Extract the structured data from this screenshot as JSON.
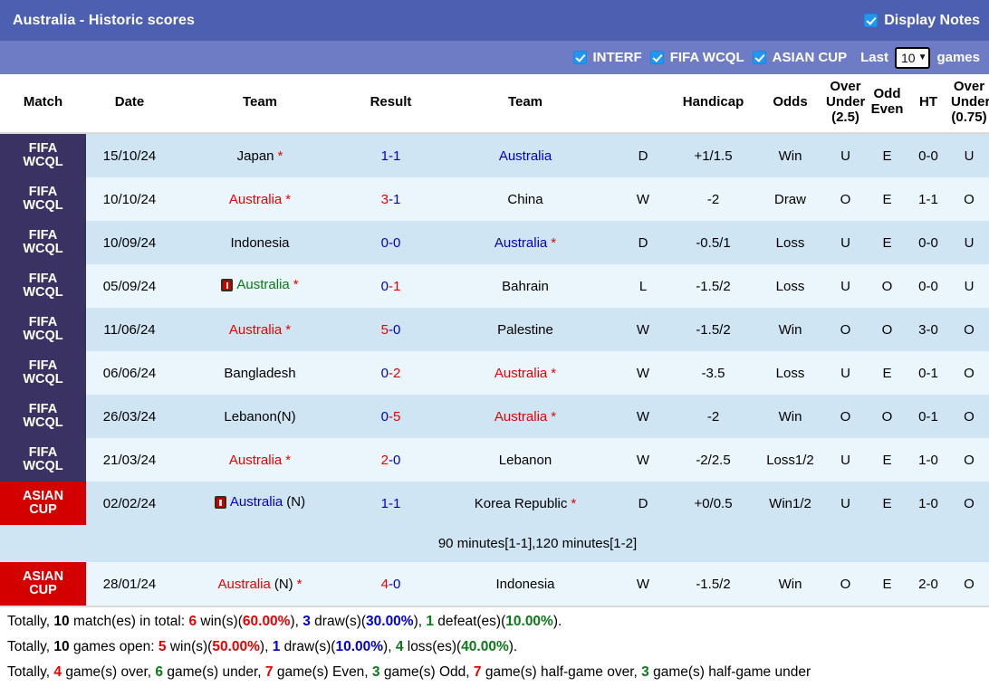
{
  "header": {
    "title": "Australia - Historic scores",
    "display_notes_label": "Display Notes",
    "display_notes_checked": true,
    "filters": [
      {
        "label": "INTERF",
        "checked": true
      },
      {
        "label": "FIFA WCQL",
        "checked": true
      },
      {
        "label": "ASIAN CUP",
        "checked": true
      }
    ],
    "last_label": "Last",
    "last_value": "10",
    "games_label": "games"
  },
  "columns": {
    "match": "Match",
    "date": "Date",
    "team_home": "Team",
    "result": "Result",
    "team_away": "Team",
    "handicap": "Handicap",
    "odds": "Odds",
    "over_under_25": "Over\nUnder\n(2.5)",
    "over_under_25_l1": "Over",
    "over_under_25_l2": "Under",
    "over_under_25_l3": "(2.5)",
    "odd_even_l1": "Odd",
    "odd_even_l2": "Even",
    "ht": "HT",
    "over_under_075_l1": "Over",
    "over_under_075_l2": "Under",
    "over_under_075_l3": "(0.75)"
  },
  "colors": {
    "titlebar": "#4d5fb0",
    "filterbar": "#6d7cc4",
    "badge_wcql": "#3a3263",
    "badge_asiancup": "#d40000",
    "row_odd": "#cfe5f3",
    "row_even": "#eaf6fb",
    "red": "#e80000",
    "blue": "#0000cd",
    "green": "#0b7a18"
  },
  "rows": [
    {
      "competition_l1": "FIFA",
      "competition_l2": "WCQL",
      "competition_type": "wcql",
      "date": "15/10/24",
      "home": {
        "name": "Japan",
        "star": true,
        "color": "black",
        "card": false,
        "suffix": ""
      },
      "score": {
        "left": "1",
        "left_color": "blue",
        "sep": "-",
        "right": "1",
        "right_color": "blue"
      },
      "away": {
        "name": "Australia",
        "star": false,
        "color": "blue",
        "card": false,
        "suffix": ""
      },
      "wdl": "D",
      "wdl_color": "blue",
      "handicap": "+1/1.5",
      "odds": "Win",
      "odds_color": "red",
      "ou25": "U",
      "ou25_color": "green",
      "oddeven": "E",
      "oddeven_color": "red",
      "ht": "0-0",
      "ou075": "U",
      "ou075_color": "green",
      "note": null
    },
    {
      "competition_l1": "FIFA",
      "competition_l2": "WCQL",
      "competition_type": "wcql",
      "date": "10/10/24",
      "home": {
        "name": "Australia",
        "star": true,
        "color": "red",
        "card": false,
        "suffix": ""
      },
      "score": {
        "left": "3",
        "left_color": "red",
        "sep": "-",
        "right": "1",
        "right_color": "blue"
      },
      "away": {
        "name": "China",
        "star": false,
        "color": "black",
        "card": false,
        "suffix": ""
      },
      "wdl": "W",
      "wdl_color": "red",
      "handicap": "-2",
      "odds": "Draw",
      "odds_color": "blue",
      "ou25": "O",
      "ou25_color": "red",
      "oddeven": "E",
      "oddeven_color": "red",
      "ht": "1-1",
      "ou075": "O",
      "ou075_color": "red",
      "note": null
    },
    {
      "competition_l1": "FIFA",
      "competition_l2": "WCQL",
      "competition_type": "wcql",
      "date": "10/09/24",
      "home": {
        "name": "Indonesia",
        "star": false,
        "color": "black",
        "card": false,
        "suffix": ""
      },
      "score": {
        "left": "0",
        "left_color": "blue",
        "sep": "-",
        "right": "0",
        "right_color": "blue"
      },
      "away": {
        "name": "Australia",
        "star": true,
        "color": "blue",
        "card": false,
        "suffix": ""
      },
      "wdl": "D",
      "wdl_color": "blue",
      "handicap": "-0.5/1",
      "odds": "Loss",
      "odds_color": "green",
      "ou25": "U",
      "ou25_color": "green",
      "oddeven": "E",
      "oddeven_color": "red",
      "ht": "0-0",
      "ou075": "U",
      "ou075_color": "green",
      "note": null
    },
    {
      "competition_l1": "FIFA",
      "competition_l2": "WCQL",
      "competition_type": "wcql",
      "date": "05/09/24",
      "home": {
        "name": "Australia",
        "star": true,
        "color": "green",
        "card": true,
        "suffix": ""
      },
      "score": {
        "left": "0",
        "left_color": "blue",
        "sep": "-",
        "right": "1",
        "right_color": "red"
      },
      "away": {
        "name": "Bahrain",
        "star": false,
        "color": "black",
        "card": false,
        "suffix": ""
      },
      "wdl": "L",
      "wdl_color": "green",
      "handicap": "-1.5/2",
      "odds": "Loss",
      "odds_color": "green",
      "ou25": "U",
      "ou25_color": "green",
      "oddeven": "O",
      "oddeven_color": "green",
      "ht": "0-0",
      "ou075": "U",
      "ou075_color": "green",
      "note": null
    },
    {
      "competition_l1": "FIFA",
      "competition_l2": "WCQL",
      "competition_type": "wcql",
      "date": "11/06/24",
      "home": {
        "name": "Australia",
        "star": true,
        "color": "red",
        "card": false,
        "suffix": ""
      },
      "score": {
        "left": "5",
        "left_color": "red",
        "sep": "-",
        "right": "0",
        "right_color": "blue"
      },
      "away": {
        "name": "Palestine",
        "star": false,
        "color": "black",
        "card": false,
        "suffix": ""
      },
      "wdl": "W",
      "wdl_color": "red",
      "handicap": "-1.5/2",
      "odds": "Win",
      "odds_color": "red",
      "ou25": "O",
      "ou25_color": "red",
      "oddeven": "O",
      "oddeven_color": "green",
      "ht": "3-0",
      "ou075": "O",
      "ou075_color": "red",
      "note": null
    },
    {
      "competition_l1": "FIFA",
      "competition_l2": "WCQL",
      "competition_type": "wcql",
      "date": "06/06/24",
      "home": {
        "name": "Bangladesh",
        "star": false,
        "color": "black",
        "card": false,
        "suffix": ""
      },
      "score": {
        "left": "0",
        "left_color": "blue",
        "sep": "-",
        "right": "2",
        "right_color": "red"
      },
      "away": {
        "name": "Australia",
        "star": true,
        "color": "red",
        "card": false,
        "suffix": ""
      },
      "wdl": "W",
      "wdl_color": "red",
      "handicap": "-3.5",
      "odds": "Loss",
      "odds_color": "green",
      "ou25": "U",
      "ou25_color": "green",
      "oddeven": "E",
      "oddeven_color": "red",
      "ht": "0-1",
      "ou075": "O",
      "ou075_color": "red",
      "note": null
    },
    {
      "competition_l1": "FIFA",
      "competition_l2": "WCQL",
      "competition_type": "wcql",
      "date": "26/03/24",
      "home": {
        "name": "Lebanon(N)",
        "star": false,
        "color": "black",
        "card": false,
        "suffix": ""
      },
      "score": {
        "left": "0",
        "left_color": "blue",
        "sep": "-",
        "right": "5",
        "right_color": "red"
      },
      "away": {
        "name": "Australia",
        "star": true,
        "color": "red",
        "card": false,
        "suffix": ""
      },
      "wdl": "W",
      "wdl_color": "red",
      "handicap": "-2",
      "odds": "Win",
      "odds_color": "red",
      "ou25": "O",
      "ou25_color": "red",
      "oddeven": "O",
      "oddeven_color": "green",
      "ht": "0-1",
      "ou075": "O",
      "ou075_color": "red",
      "note": null
    },
    {
      "competition_l1": "FIFA",
      "competition_l2": "WCQL",
      "competition_type": "wcql",
      "date": "21/03/24",
      "home": {
        "name": "Australia",
        "star": true,
        "color": "red",
        "card": false,
        "suffix": ""
      },
      "score": {
        "left": "2",
        "left_color": "red",
        "sep": "-",
        "right": "0",
        "right_color": "blue"
      },
      "away": {
        "name": "Lebanon",
        "star": false,
        "color": "black",
        "card": false,
        "suffix": ""
      },
      "wdl": "W",
      "wdl_color": "red",
      "handicap": "-2/2.5",
      "odds": "Loss1/2",
      "odds_color": "green",
      "ou25": "U",
      "ou25_color": "green",
      "oddeven": "E",
      "oddeven_color": "red",
      "ht": "1-0",
      "ou075": "O",
      "ou075_color": "red",
      "note": null
    },
    {
      "competition_l1": "ASIAN",
      "competition_l2": "CUP",
      "competition_type": "acup",
      "date": "02/02/24",
      "home": {
        "name": "Australia",
        "star": false,
        "color": "blue",
        "card": true,
        "suffix": "(N)"
      },
      "score": {
        "left": "1",
        "left_color": "blue",
        "sep": "-",
        "right": "1",
        "right_color": "blue"
      },
      "away": {
        "name": "Korea Republic",
        "star": true,
        "color": "black",
        "card": false,
        "suffix": ""
      },
      "wdl": "D",
      "wdl_color": "blue",
      "handicap": "+0/0.5",
      "odds": "Win1/2",
      "odds_color": "red",
      "ou25": "U",
      "ou25_color": "green",
      "oddeven": "E",
      "oddeven_color": "red",
      "ht": "1-0",
      "ou075": "O",
      "ou075_color": "red",
      "note": "90 minutes[1-1],120 minutes[1-2]"
    },
    {
      "competition_l1": "ASIAN",
      "competition_l2": "CUP",
      "competition_type": "acup",
      "date": "28/01/24",
      "home": {
        "name": "Australia",
        "star": true,
        "color": "red",
        "card": false,
        "suffix": "(N)"
      },
      "score": {
        "left": "4",
        "left_color": "red",
        "sep": "-",
        "right": "0",
        "right_color": "blue"
      },
      "away": {
        "name": "Indonesia",
        "star": false,
        "color": "black",
        "card": false,
        "suffix": ""
      },
      "wdl": "W",
      "wdl_color": "red",
      "handicap": "-1.5/2",
      "odds": "Win",
      "odds_color": "red",
      "ou25": "O",
      "ou25_color": "red",
      "oddeven": "E",
      "oddeven_color": "red",
      "ht": "2-0",
      "ou075": "O",
      "ou075_color": "red",
      "note": null
    }
  ],
  "summary": {
    "line1": {
      "prefix": "Totally, ",
      "total": "10",
      "t1": " match(es) in total: ",
      "wins": "6",
      "t2": " win(s)(",
      "wins_pct": "60.00%",
      "t3": "), ",
      "draws": "3",
      "t4": " draw(s)(",
      "draws_pct": "30.00%",
      "t5": "), ",
      "defeats": "1",
      "t6": " defeat(es)(",
      "defeats_pct": "10.00%",
      "t7": ")."
    },
    "line2": {
      "prefix": "Totally, ",
      "total": "10",
      "t1": " games open: ",
      "wins": "5",
      "t2": " win(s)(",
      "wins_pct": "50.00%",
      "t3": "), ",
      "draws": "1",
      "t4": " draw(s)(",
      "draws_pct": "10.00%",
      "t5": "), ",
      "losses": "4",
      "t6": " loss(es)(",
      "losses_pct": "40.00%",
      "t7": ")."
    },
    "line3": {
      "prefix": "Totally, ",
      "over": "4",
      "t1": " game(s) over, ",
      "under": "6",
      "t2": " game(s) under, ",
      "even": "7",
      "t3": " game(s) Even, ",
      "odd": "3",
      "t4": " game(s) Odd, ",
      "half_over": "7",
      "t5": " game(s) half-game over, ",
      "half_under": "3",
      "t6": " game(s) half-game under"
    }
  }
}
